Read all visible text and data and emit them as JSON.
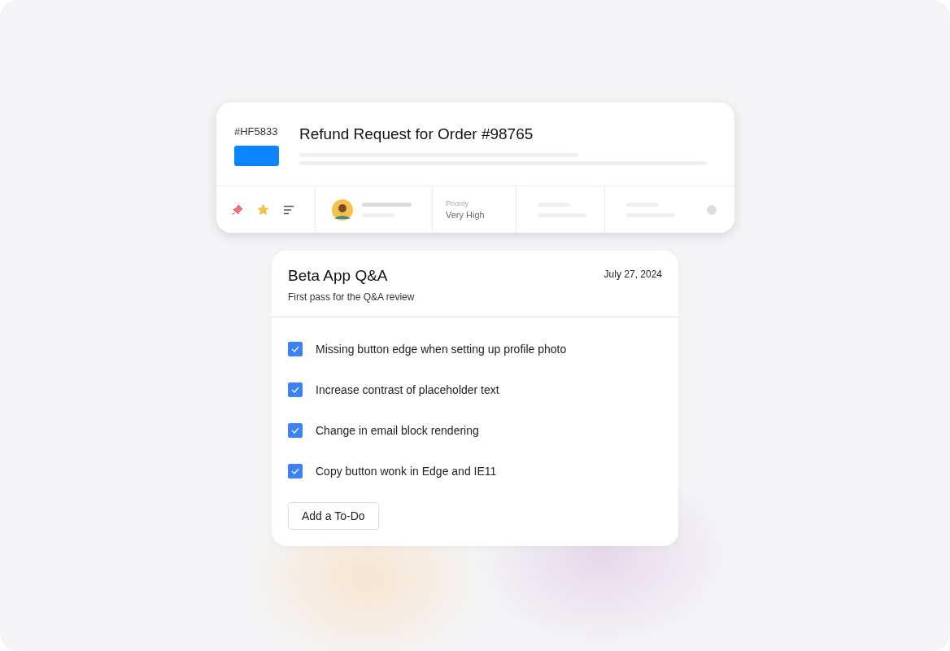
{
  "ticket": {
    "id": "#HF5833",
    "title": "Refund Request for Order #98765",
    "priority_label": "Priority",
    "priority_value": "Very High"
  },
  "todo": {
    "title": "Beta App Q&A",
    "subtitle": "First pass for the Q&A review",
    "date": "July 27, 2024",
    "items": [
      {
        "label": "Missing button edge when setting up profile photo",
        "checked": true
      },
      {
        "label": "Increase contrast of placeholder text",
        "checked": true
      },
      {
        "label": "Change in email block rendering",
        "checked": true
      },
      {
        "label": "Copy button wonk in Edge and IE11",
        "checked": true
      }
    ],
    "add_button": "Add a To-Do"
  }
}
